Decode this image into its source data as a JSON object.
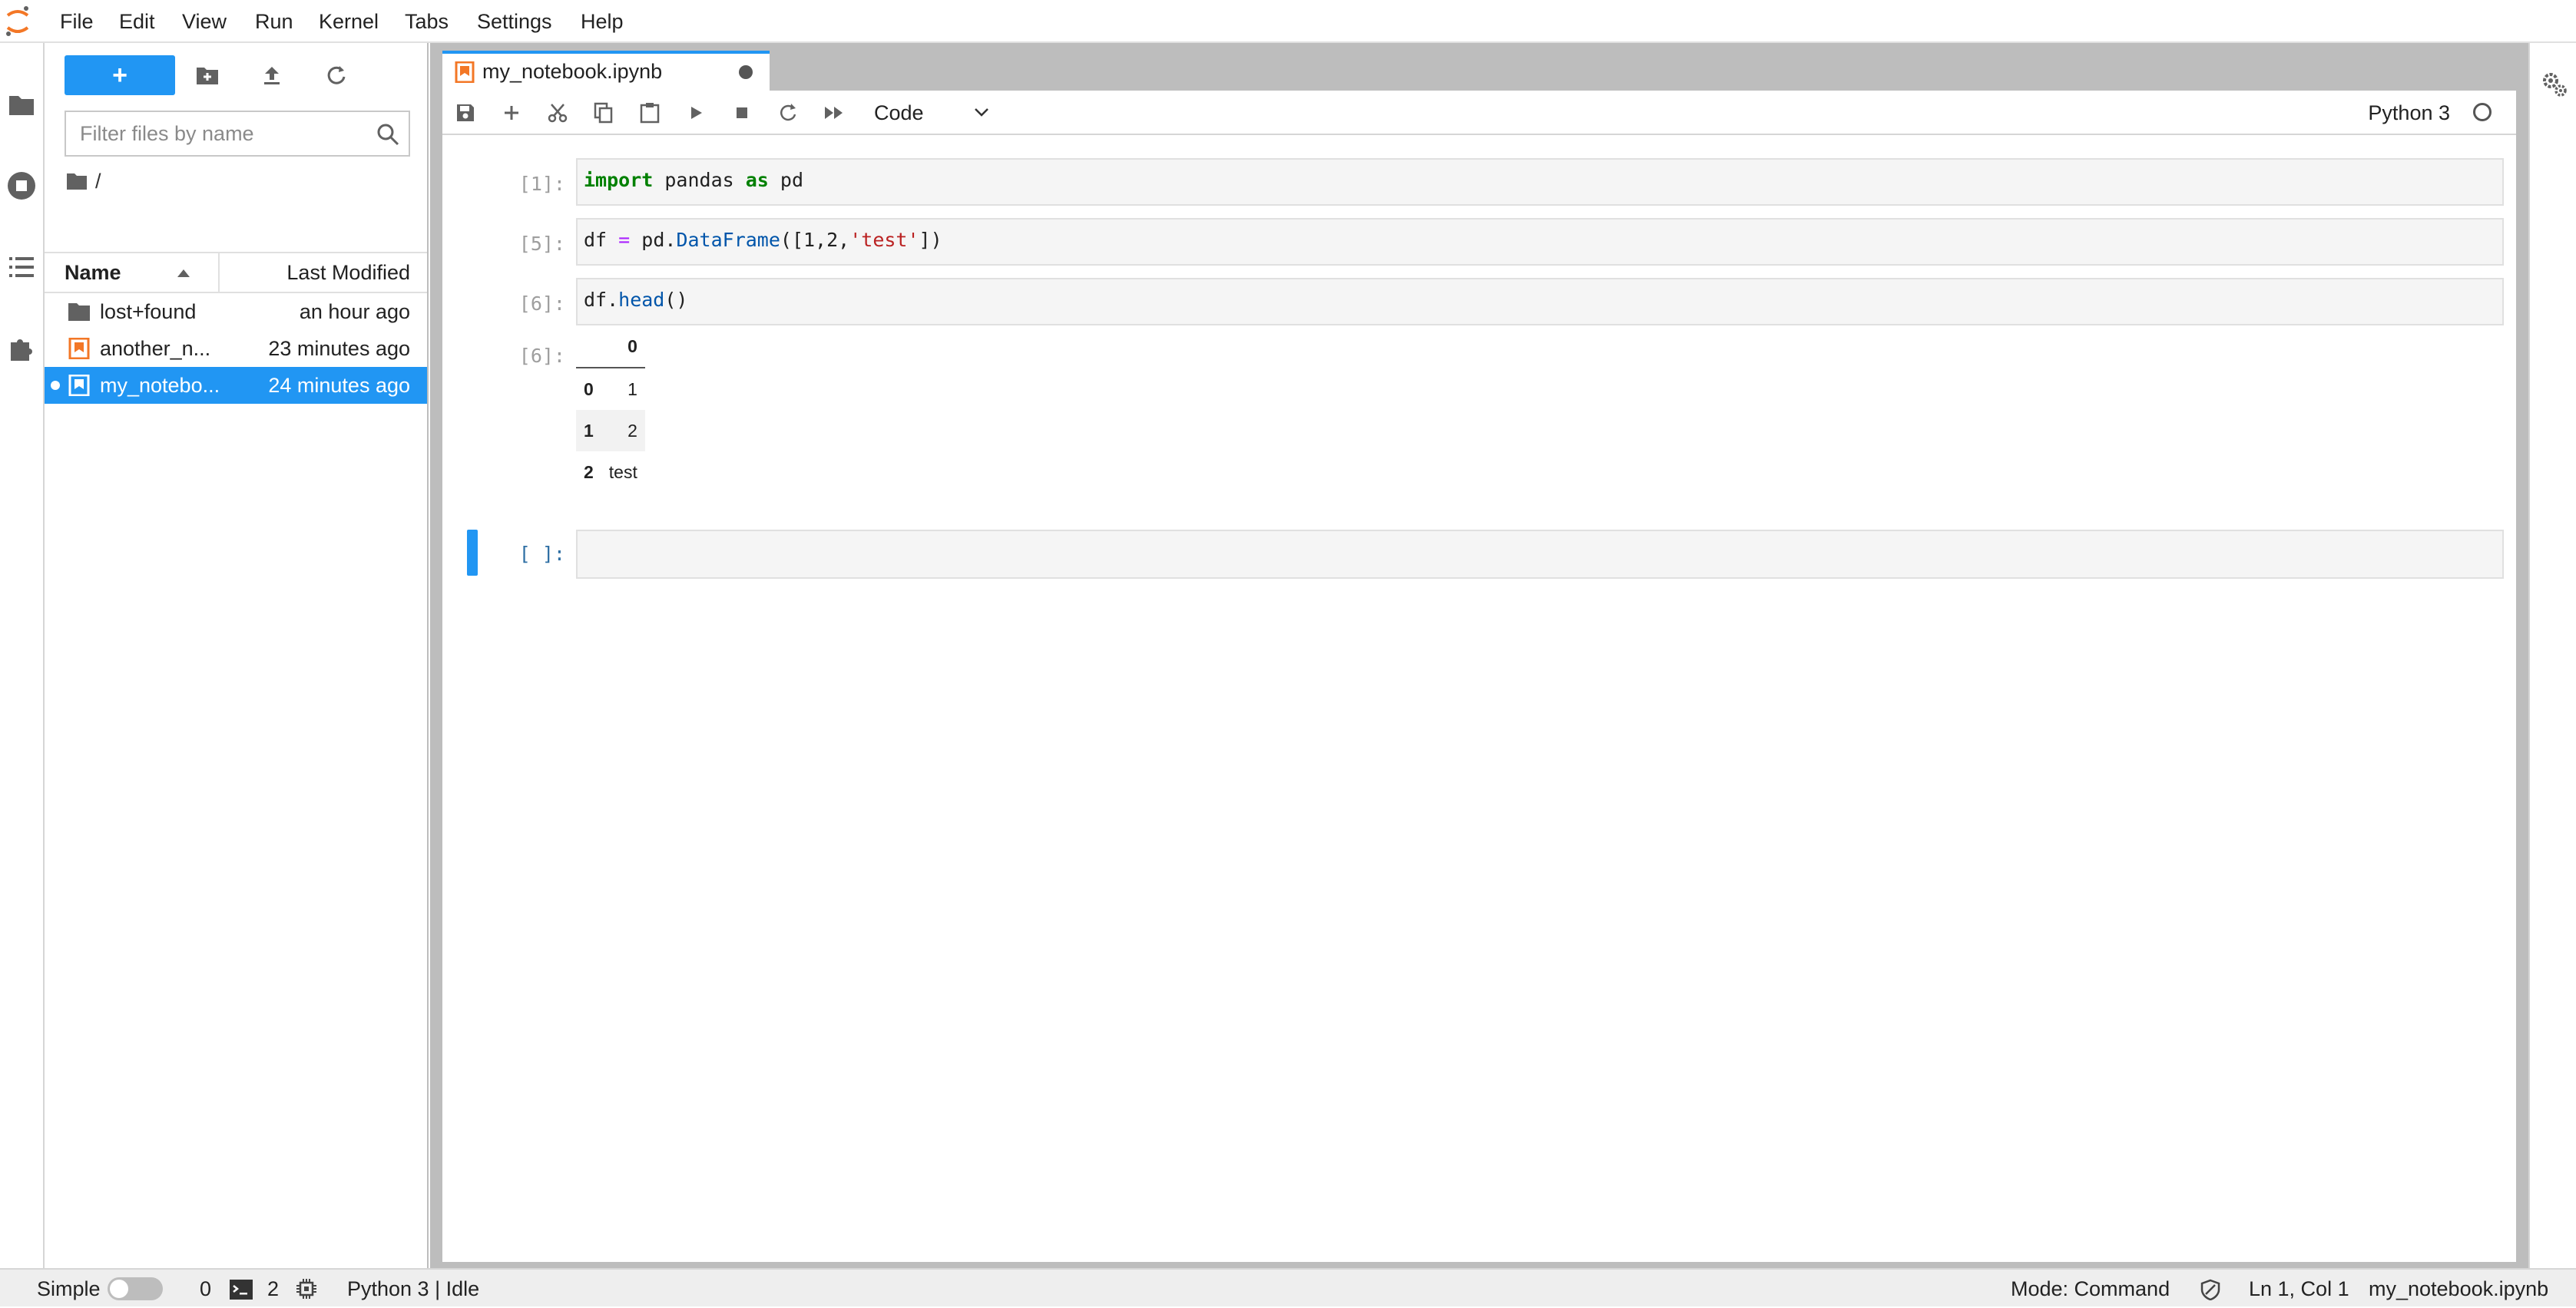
{
  "menu": [
    "File",
    "Edit",
    "View",
    "Run",
    "Kernel",
    "Tabs",
    "Settings",
    "Help"
  ],
  "filebrowser": {
    "new_label": "+",
    "filter_placeholder": "Filter files by name",
    "breadcrumb": "/",
    "columns": {
      "name": "Name",
      "modified": "Last Modified"
    },
    "items": [
      {
        "name": "lost+found",
        "modified": "an hour ago",
        "type": "folder"
      },
      {
        "name": "another_n...",
        "modified": "23 minutes ago",
        "type": "notebook"
      },
      {
        "name": "my_notebo...",
        "modified": "24 minutes ago",
        "type": "notebook",
        "selected": true,
        "running": true
      }
    ]
  },
  "tab": {
    "title": "my_notebook.ipynb",
    "dirty": true
  },
  "toolbar": {
    "cell_type": "Code",
    "kernel": "Python 3"
  },
  "cells": [
    {
      "prompt": "[1]:",
      "source": "import pandas as pd"
    },
    {
      "prompt": "[5]:",
      "source": "df = pd.DataFrame([1,2,'test'])"
    },
    {
      "prompt": "[6]:",
      "source": "df.head()"
    },
    {
      "prompt": "[ ]:",
      "source": ""
    }
  ],
  "output": {
    "prompt": "[6]:",
    "columns": [
      "",
      "0"
    ],
    "rows": [
      [
        "0",
        "1"
      ],
      [
        "1",
        "2"
      ],
      [
        "2",
        "test"
      ]
    ]
  },
  "status": {
    "mode_label": "Simple",
    "terminals": "0",
    "kernels": "2",
    "kernel_status": "Python 3 | Idle",
    "mode": "Mode: Command",
    "position": "Ln 1, Col 1",
    "filename": "my_notebook.ipynb"
  },
  "colors": {
    "accent": "#2196f3",
    "jupyter_orange": "#f37726"
  }
}
